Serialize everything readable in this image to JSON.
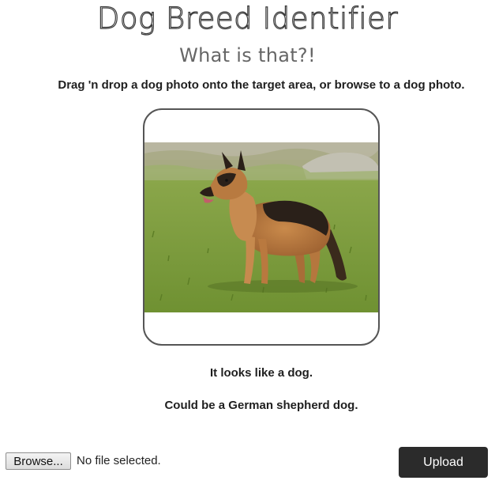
{
  "header": {
    "title": "Dog Breed Identifier",
    "subtitle": "What is that?!"
  },
  "instructions": "Drag 'n drop a dog photo onto the target area, or browse to a dog photo.",
  "drop_target": {
    "photo_alt": "German shepherd dog standing on grass"
  },
  "result": {
    "line1": "It looks like a dog.",
    "line2": "Could be a German shepherd dog."
  },
  "file_input": {
    "browse_label": "Browse...",
    "status": "No file selected."
  },
  "upload_label": "Upload"
}
